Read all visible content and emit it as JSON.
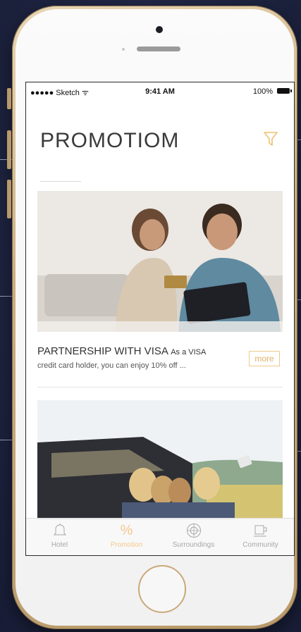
{
  "status_bar": {
    "carrier": "●●●●● Sketch ᯤ",
    "time": "9:41 AM",
    "battery": "100%"
  },
  "header": {
    "title": "PROMOTIOM",
    "filter_icon": "filter-icon"
  },
  "cards": [
    {
      "headline": "PARTNERSHIP WITH VISA",
      "lead_in": "As a VISA",
      "description": "credit card holder, you can enjoy 10% off ...",
      "more_label": "more",
      "image": "couple-with-credit-card-and-tablet"
    },
    {
      "image": "friends-taking-selfie-in-car"
    }
  ],
  "tabbar": {
    "items": [
      {
        "label": "Hotel",
        "icon": "bell-icon",
        "active": false
      },
      {
        "label": "Promotion",
        "icon": "percent-icon",
        "active": true
      },
      {
        "label": "Surroundings",
        "icon": "compass-icon",
        "active": false
      },
      {
        "label": "Community",
        "icon": "cup-icon",
        "active": false
      }
    ]
  },
  "colors": {
    "accent": "#f3c88b",
    "background": "#1f2542",
    "phone_frame": "#c9ad80"
  }
}
